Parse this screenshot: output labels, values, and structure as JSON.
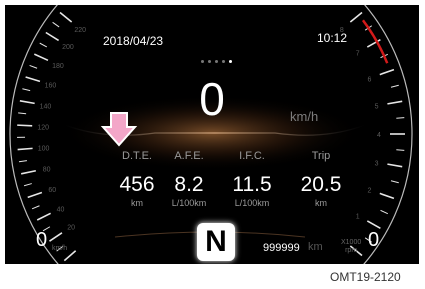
{
  "status_bar": {
    "date": "2018/04/23",
    "time": "10:12"
  },
  "page_indicator": {
    "count": 5,
    "active_index": 4
  },
  "speed": {
    "value": "0",
    "unit": "km/h"
  },
  "speedometer": {
    "ticks": [
      "220",
      "200",
      "180",
      "160",
      "140",
      "120",
      "100",
      "80",
      "60",
      "40",
      "20"
    ],
    "zero_label": "0",
    "unit": "km/h"
  },
  "tachometer": {
    "ticks": [
      "8",
      "7",
      "6",
      "5",
      "4",
      "3",
      "2",
      "1"
    ],
    "zero_label": "0",
    "unit_line1": "X1000",
    "unit_line2": "rpm",
    "redline_color": "#d21a1a"
  },
  "stats": [
    {
      "label": "D.T.E.",
      "value": "456",
      "unit": "km"
    },
    {
      "label": "A.F.E.",
      "value": "8.2",
      "unit": "L/100km"
    },
    {
      "label": "I.F.C.",
      "value": "11.5",
      "unit": "L/100km"
    },
    {
      "label": "Trip",
      "value": "20.5",
      "unit": "km"
    }
  ],
  "gear": "N",
  "odometer": {
    "value": "999999",
    "unit": "km"
  },
  "pointer_arrow_color": "#f3a6c8",
  "caption": "OMT19-2120"
}
